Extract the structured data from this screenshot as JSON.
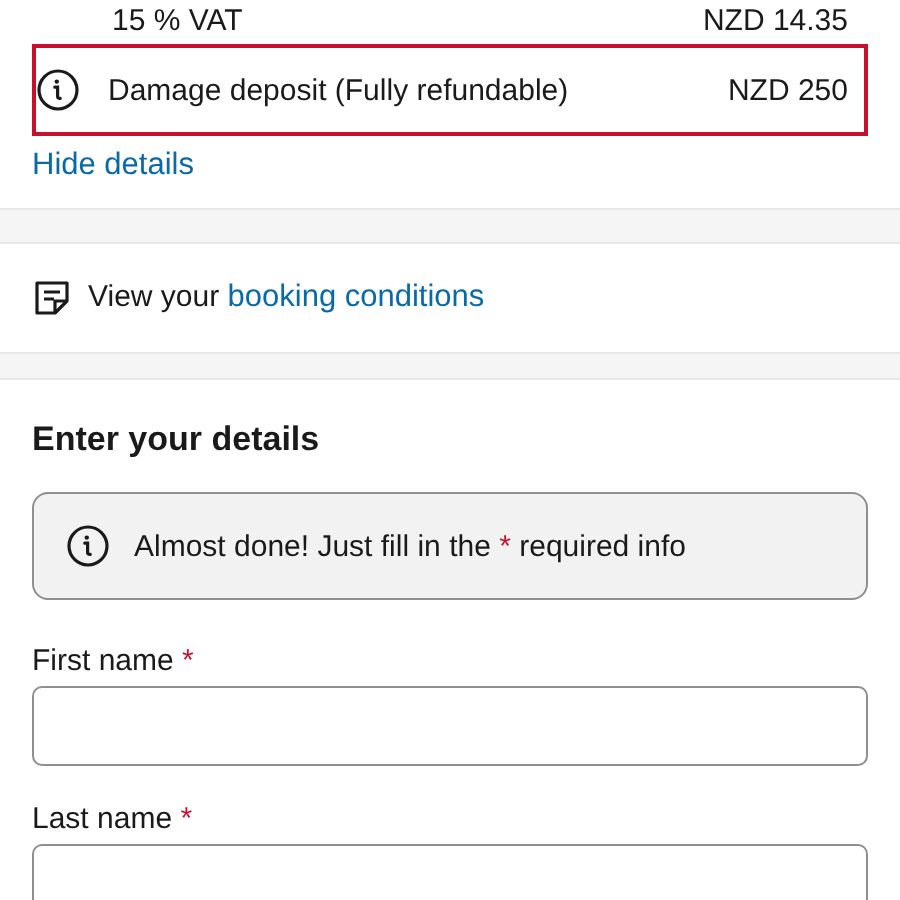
{
  "price_rows": [
    {
      "label": "15 % VAT",
      "amount": "NZD 14.35",
      "info": false,
      "highlighted": false
    },
    {
      "label": "Damage deposit (Fully refundable)",
      "amount": "NZD 250",
      "info": true,
      "highlighted": true
    }
  ],
  "toggle_link": "Hide details",
  "conditions": {
    "text": "View your",
    "link": "booking conditions"
  },
  "details": {
    "heading": "Enter your details",
    "notice": {
      "before": "Almost done! Just fill in the",
      "mark": "*",
      "after": "required info"
    },
    "fields": [
      {
        "label": "First name",
        "required_mark": "*"
      },
      {
        "label": "Last name",
        "required_mark": "*"
      }
    ]
  }
}
